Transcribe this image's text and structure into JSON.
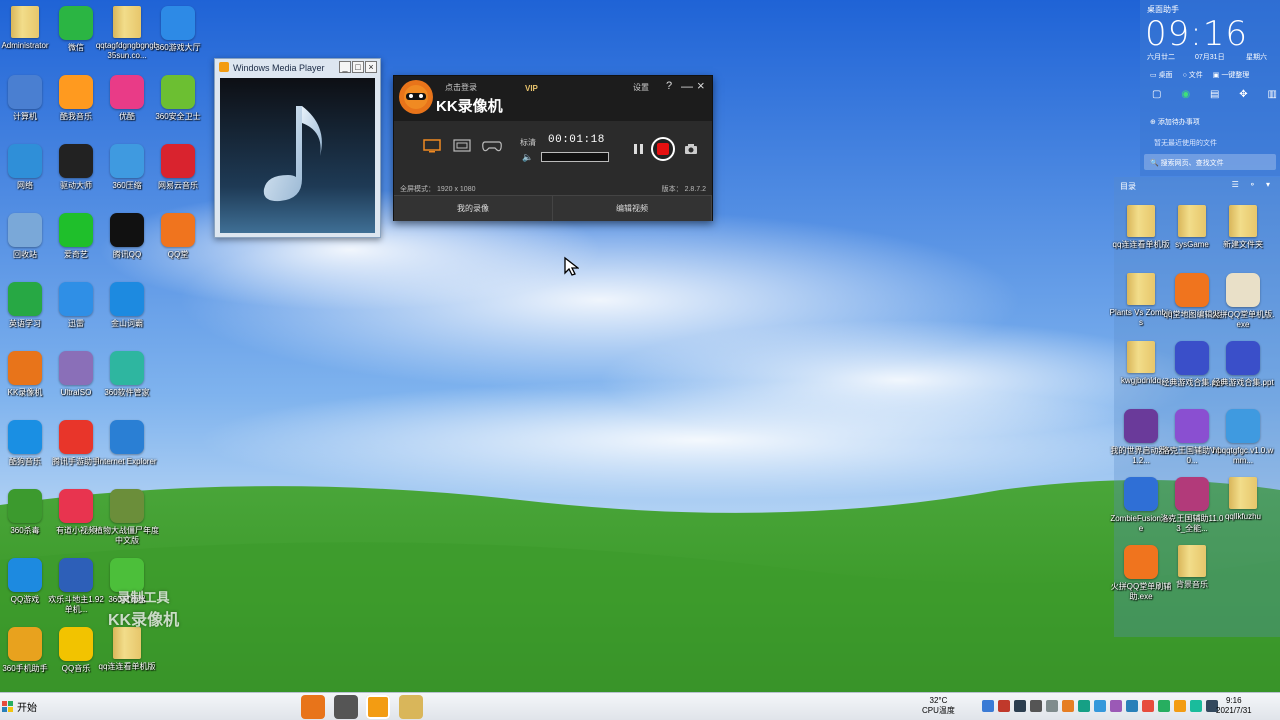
{
  "desktop_icons": [
    {
      "label": "Administrator",
      "icon": "user-folder-icon",
      "color": "#d9b65a",
      "col": 0,
      "row": 0
    },
    {
      "label": "微信",
      "icon": "wechat-icon",
      "color": "#2bb543",
      "col": 1,
      "row": 0
    },
    {
      "label": "qqtagfdgngbgngb35sun.co...",
      "icon": "folder-icon",
      "color": "#3f9ae0",
      "col": 2,
      "row": 0
    },
    {
      "label": "360游戏大厅",
      "icon": "game-hall-icon",
      "color": "#2d8ae6",
      "col": 3,
      "row": 0
    },
    {
      "label": "计算机",
      "icon": "computer-icon",
      "color": "#4a7fd1",
      "col": 0,
      "row": 1
    },
    {
      "label": "酷我音乐",
      "icon": "kuwo-music-icon",
      "color": "#ff9a1f",
      "col": 1,
      "row": 1
    },
    {
      "label": "优酷",
      "icon": "youku-icon",
      "color": "#e93b87",
      "col": 2,
      "row": 1
    },
    {
      "label": "360安全卫士",
      "icon": "360-guard-icon",
      "color": "#6cbf32",
      "col": 3,
      "row": 1
    },
    {
      "label": "网络",
      "icon": "network-icon",
      "color": "#2f8fd8",
      "col": 0,
      "row": 2
    },
    {
      "label": "驱动大师",
      "icon": "driver-icon",
      "color": "#222222",
      "col": 1,
      "row": 2
    },
    {
      "label": "360压缩",
      "icon": "zip-icon",
      "color": "#3f9ae0",
      "col": 2,
      "row": 2
    },
    {
      "label": "网易云音乐",
      "icon": "netease-music-icon",
      "color": "#d9232e",
      "col": 3,
      "row": 2
    },
    {
      "label": "回收站",
      "icon": "recycle-bin-icon",
      "color": "#7aa8d8",
      "col": 0,
      "row": 3
    },
    {
      "label": "爱奇艺",
      "icon": "iqiyi-icon",
      "color": "#1fbf2b",
      "col": 1,
      "row": 3
    },
    {
      "label": "腾讯QQ",
      "icon": "qq-penguin-icon",
      "color": "#111111",
      "col": 2,
      "row": 3
    },
    {
      "label": "QQ堂",
      "icon": "qq-tang-icon",
      "color": "#f0741e",
      "col": 3,
      "row": 3
    },
    {
      "label": "英语学习",
      "icon": "english-icon",
      "color": "#27a844",
      "col": 0,
      "row": 4
    },
    {
      "label": "迅雷",
      "icon": "thunder-icon",
      "color": "#2f8fe6",
      "col": 1,
      "row": 4
    },
    {
      "label": "金山词霸",
      "icon": "dict-icon",
      "color": "#1d8ae0",
      "col": 2,
      "row": 4
    },
    {
      "label": "KK录像机",
      "icon": "kk-recorder-icon",
      "color": "#e8741a",
      "col": 0,
      "row": 5
    },
    {
      "label": "UltraISO",
      "icon": "disc-icon",
      "color": "#8a6fb8",
      "col": 1,
      "row": 5
    },
    {
      "label": "360软件管家",
      "icon": "software-manager-icon",
      "color": "#2eb6a0",
      "col": 2,
      "row": 5
    },
    {
      "label": "酷狗音乐",
      "icon": "kugou-icon",
      "color": "#1a8fe3",
      "col": 0,
      "row": 6
    },
    {
      "label": "腾讯手游助手",
      "icon": "mobile-game-icon",
      "color": "#e8352a",
      "col": 1,
      "row": 6
    },
    {
      "label": "Internet Explorer",
      "icon": "ie-icon",
      "color": "#2a7fd4",
      "col": 2,
      "row": 6
    },
    {
      "label": "360杀毒",
      "icon": "360-antivirus-icon",
      "color": "#3c9a2e",
      "col": 0,
      "row": 7
    },
    {
      "label": "有道小视频",
      "icon": "youdao-icon",
      "color": "#e8344f",
      "col": 1,
      "row": 7
    },
    {
      "label": "植物大战僵尸年度中文版",
      "icon": "pvz-icon",
      "color": "#6b8e3a",
      "col": 2,
      "row": 7
    },
    {
      "label": "QQ游戏",
      "icon": "qq-game-icon",
      "color": "#1d8ae0",
      "col": 0,
      "row": 8
    },
    {
      "label": "欢乐斗地主1.92 单机...",
      "icon": "landlord-icon",
      "color": "#2d5fb8",
      "col": 1,
      "row": 8
    },
    {
      "label": "360浏览器",
      "icon": "360-browser-icon",
      "color": "#4cbf3a",
      "col": 2,
      "row": 8
    },
    {
      "label": "360手机助手",
      "icon": "360-phone-icon",
      "color": "#e8a21e",
      "col": 0,
      "row": 9
    },
    {
      "label": "QQ音乐",
      "icon": "qq-music-icon",
      "color": "#f2c300",
      "col": 1,
      "row": 9
    },
    {
      "label": "qq连连看单机版",
      "icon": "folder-icon",
      "color": "#d9b65a",
      "col": 2,
      "row": 9
    }
  ],
  "wmp": {
    "title": "Windows Media Player",
    "min": "_",
    "max": "□",
    "close": "×"
  },
  "kk": {
    "login": "点击登录",
    "brand": "KK录像机",
    "vip": "VIP",
    "settings": "设置",
    "help": "?",
    "min": "—",
    "close": "×",
    "quality": "标清",
    "timer": "00:01:18",
    "volume_fill": 0,
    "mode": "全屏模式： 1920 x 1080",
    "version": "版本： 2.8.7.2",
    "my_recordings": "我的录像",
    "edit_video": "编辑视频"
  },
  "widget": {
    "title": "桌面助手",
    "clock": "09:16",
    "lunar": "六月廿二",
    "date": "07月31日",
    "weekday": "星期六",
    "desktop": "桌面",
    "file": "文件",
    "tidy": "一键整理",
    "add_todo": "添加待办事项",
    "recent": "暂无最近使用的文件",
    "search": "搜索网页、查找文件"
  },
  "rpanel": {
    "title": "目录",
    "items": [
      {
        "label": "qq连连看单机版",
        "icon": "folder-icon",
        "color": "#d9b65a"
      },
      {
        "label": "sysGame",
        "icon": "folder-icon",
        "color": "#d9b65a"
      },
      {
        "label": "新建文件夹",
        "icon": "folder-icon",
        "color": "#d9b65a"
      },
      {
        "label": "Plants Vs Zombies",
        "icon": "folder-icon",
        "color": "#d9b65a"
      },
      {
        "label": "qq堂地图编辑器",
        "icon": "qq-tang-icon",
        "color": "#f0741e"
      },
      {
        "label": "火拼QQ堂单机版.exe",
        "icon": "game-icon",
        "color": "#e9e0c8"
      },
      {
        "label": "kwgjbdnldq",
        "icon": "folder-icon",
        "color": "#d9b65a"
      },
      {
        "label": "经典游戏合集.ppt",
        "icon": "ppt-icon",
        "color": "#3a4fc9"
      },
      {
        "label": "经典游戏合集.ppt",
        "icon": "ppt-icon",
        "color": "#3a4fc9"
      },
      {
        "label": "我的世界启动器V1.2...",
        "icon": "game-icon",
        "color": "#6a3a9a"
      },
      {
        "label": "洛克王国辅助V4.0...",
        "icon": "game-icon",
        "color": "#8a4fd1"
      },
      {
        "label": "hpqqtgfgc.v1.0.wmm...",
        "icon": "zip-icon",
        "color": "#3f9ae0"
      },
      {
        "label": "ZombieFusion.exe",
        "icon": "earth-icon",
        "color": "#2f6fd6"
      },
      {
        "label": "洛克王国辅助11.03_全能...",
        "icon": "game-icon",
        "color": "#b23a7a"
      },
      {
        "label": "qqllkfuzhu",
        "icon": "folder-icon",
        "color": "#d9b65a"
      },
      {
        "label": "火拼QQ堂单刷辅助.exe",
        "icon": "qq-tang-icon",
        "color": "#f0741e"
      },
      {
        "label": "背景音乐",
        "icon": "folder-icon",
        "color": "#d9b65a"
      }
    ]
  },
  "watermark": {
    "line1": "录制工具",
    "line2": "KK录像机"
  },
  "taskbar": {
    "start": "开始",
    "apps": [
      {
        "icon": "kk-recorder-icon",
        "color": "#e8741a"
      },
      {
        "icon": "avatar-icon",
        "color": "#555555"
      },
      {
        "icon": "media-player-icon",
        "color": "#f39c12"
      },
      {
        "icon": "explorer-icon",
        "color": "#d9b65a"
      }
    ],
    "temp": "32°C",
    "cpu": "CPU温度",
    "time": "9:16",
    "date": "2021/7/31",
    "tray": [
      "#3a7bd5",
      "#c0392b",
      "#2c3e50",
      "#555555",
      "#7f8c8d",
      "#e67e22",
      "#16a085",
      "#3498db",
      "#9b59b6",
      "#2980b9",
      "#e74c3c",
      "#27ae60",
      "#f39c12",
      "#1abc9c",
      "#34495e"
    ]
  }
}
